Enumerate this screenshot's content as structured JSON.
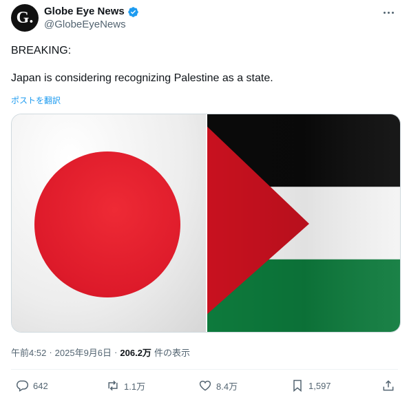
{
  "account": {
    "avatar_letter": "G.",
    "display_name": "Globe Eye News",
    "handle": "@GlobeEyeNews",
    "verified_color": "#1d9bf0"
  },
  "post": {
    "text": "BREAKING:\n\nJapan is considering recognizing Palestine as a state.",
    "translate_label": "ポストを翻訳"
  },
  "media": {
    "left_flag": "Japan flag image",
    "right_flag": "Palestine flag image"
  },
  "meta": {
    "time": "午前4:52",
    "dot1": "·",
    "date": "2025年9月6日",
    "dot2": "·",
    "views": "206.2万",
    "views_label": "件の表示"
  },
  "actions": {
    "replies": "642",
    "reposts": "1.1万",
    "likes": "8.4万",
    "bookmarks": "1,597"
  },
  "colors": {
    "text": "#0f1419",
    "secondary": "#536471",
    "link": "#1d9bf0",
    "jp_red": "#dd1a2a",
    "ps_red": "#ce1126",
    "ps_green": "#007a3d"
  }
}
